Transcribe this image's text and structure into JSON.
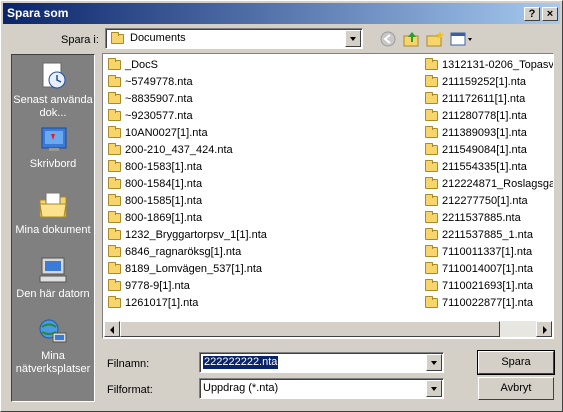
{
  "title": "Spara som",
  "titlebar_buttons": {
    "help": "?",
    "close": "×"
  },
  "save_in": {
    "label": "Spara i:",
    "value": "Documents"
  },
  "places": [
    {
      "label": "Senast använda dok...",
      "icon": "recent-documents-icon"
    },
    {
      "label": "Skrivbord",
      "icon": "desktop-icon"
    },
    {
      "label": "Mina dokument",
      "icon": "my-documents-icon"
    },
    {
      "label": "Den här datorn",
      "icon": "my-computer-icon"
    },
    {
      "label": "Mina nätverksplatser",
      "icon": "network-places-icon"
    }
  ],
  "files_col1": [
    "_DocS",
    "~5749778.nta",
    "~8835907.nta",
    "~9230577.nta",
    "10AN0027[1].nta",
    "200-210_437_424.nta",
    "800-1583[1].nta",
    "800-1584[1].nta",
    "800-1585[1].nta",
    "800-1869[1].nta",
    "1232_Bryggartorpsv_1[1].nta",
    "6846_ragnaröksg[1].nta",
    "8189_Lomvägen_537[1].nta",
    "9778-9[1].nta",
    "1261017[1].nta"
  ],
  "files_col2": [
    "1312131-0206_Topasvä",
    "211159252[1].nta",
    "211172611[1].nta",
    "211280778[1].nta",
    "211389093[1].nta",
    "211549084[1].nta",
    "211554335[1].nta",
    "212224871_Roslagsgat",
    "212277750[1].nta",
    "2211537885.nta",
    "2211537885_1.nta",
    "7110011337[1].nta",
    "7110014007[1].nta",
    "7110021693[1].nta",
    "7110022877[1].nta"
  ],
  "filename": {
    "label": "Filnamn:",
    "value": "222222222.nta"
  },
  "filetype": {
    "label": "Filformat:",
    "value": "Uppdrag (*.nta)"
  },
  "buttons": {
    "save": "Spara",
    "cancel": "Avbryt"
  },
  "colors": {
    "titlebar_start": "#0a246a",
    "titlebar_end": "#a6caf0",
    "places_bg": "#808080",
    "selection": "#0a246a"
  }
}
